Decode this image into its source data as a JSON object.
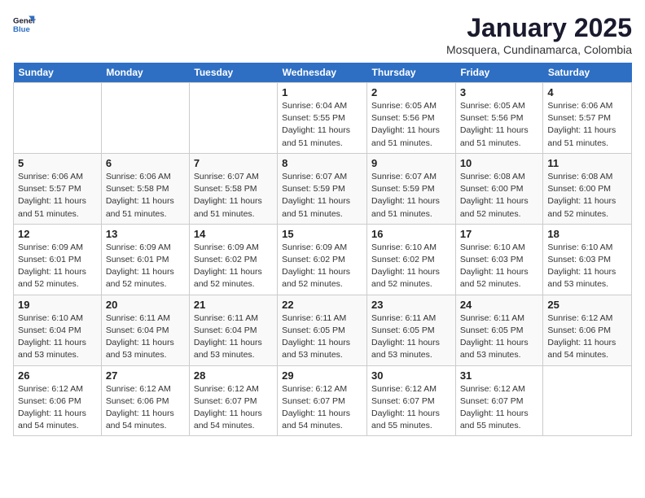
{
  "header": {
    "logo_line1": "General",
    "logo_line2": "Blue",
    "month": "January 2025",
    "location": "Mosquera, Cundinamarca, Colombia"
  },
  "days_of_week": [
    "Sunday",
    "Monday",
    "Tuesday",
    "Wednesday",
    "Thursday",
    "Friday",
    "Saturday"
  ],
  "weeks": [
    [
      {
        "day": "",
        "info": ""
      },
      {
        "day": "",
        "info": ""
      },
      {
        "day": "",
        "info": ""
      },
      {
        "day": "1",
        "info": "Sunrise: 6:04 AM\nSunset: 5:55 PM\nDaylight: 11 hours\nand 51 minutes."
      },
      {
        "day": "2",
        "info": "Sunrise: 6:05 AM\nSunset: 5:56 PM\nDaylight: 11 hours\nand 51 minutes."
      },
      {
        "day": "3",
        "info": "Sunrise: 6:05 AM\nSunset: 5:56 PM\nDaylight: 11 hours\nand 51 minutes."
      },
      {
        "day": "4",
        "info": "Sunrise: 6:06 AM\nSunset: 5:57 PM\nDaylight: 11 hours\nand 51 minutes."
      }
    ],
    [
      {
        "day": "5",
        "info": "Sunrise: 6:06 AM\nSunset: 5:57 PM\nDaylight: 11 hours\nand 51 minutes."
      },
      {
        "day": "6",
        "info": "Sunrise: 6:06 AM\nSunset: 5:58 PM\nDaylight: 11 hours\nand 51 minutes."
      },
      {
        "day": "7",
        "info": "Sunrise: 6:07 AM\nSunset: 5:58 PM\nDaylight: 11 hours\nand 51 minutes."
      },
      {
        "day": "8",
        "info": "Sunrise: 6:07 AM\nSunset: 5:59 PM\nDaylight: 11 hours\nand 51 minutes."
      },
      {
        "day": "9",
        "info": "Sunrise: 6:07 AM\nSunset: 5:59 PM\nDaylight: 11 hours\nand 51 minutes."
      },
      {
        "day": "10",
        "info": "Sunrise: 6:08 AM\nSunset: 6:00 PM\nDaylight: 11 hours\nand 52 minutes."
      },
      {
        "day": "11",
        "info": "Sunrise: 6:08 AM\nSunset: 6:00 PM\nDaylight: 11 hours\nand 52 minutes."
      }
    ],
    [
      {
        "day": "12",
        "info": "Sunrise: 6:09 AM\nSunset: 6:01 PM\nDaylight: 11 hours\nand 52 minutes."
      },
      {
        "day": "13",
        "info": "Sunrise: 6:09 AM\nSunset: 6:01 PM\nDaylight: 11 hours\nand 52 minutes."
      },
      {
        "day": "14",
        "info": "Sunrise: 6:09 AM\nSunset: 6:02 PM\nDaylight: 11 hours\nand 52 minutes."
      },
      {
        "day": "15",
        "info": "Sunrise: 6:09 AM\nSunset: 6:02 PM\nDaylight: 11 hours\nand 52 minutes."
      },
      {
        "day": "16",
        "info": "Sunrise: 6:10 AM\nSunset: 6:02 PM\nDaylight: 11 hours\nand 52 minutes."
      },
      {
        "day": "17",
        "info": "Sunrise: 6:10 AM\nSunset: 6:03 PM\nDaylight: 11 hours\nand 52 minutes."
      },
      {
        "day": "18",
        "info": "Sunrise: 6:10 AM\nSunset: 6:03 PM\nDaylight: 11 hours\nand 53 minutes."
      }
    ],
    [
      {
        "day": "19",
        "info": "Sunrise: 6:10 AM\nSunset: 6:04 PM\nDaylight: 11 hours\nand 53 minutes."
      },
      {
        "day": "20",
        "info": "Sunrise: 6:11 AM\nSunset: 6:04 PM\nDaylight: 11 hours\nand 53 minutes."
      },
      {
        "day": "21",
        "info": "Sunrise: 6:11 AM\nSunset: 6:04 PM\nDaylight: 11 hours\nand 53 minutes."
      },
      {
        "day": "22",
        "info": "Sunrise: 6:11 AM\nSunset: 6:05 PM\nDaylight: 11 hours\nand 53 minutes."
      },
      {
        "day": "23",
        "info": "Sunrise: 6:11 AM\nSunset: 6:05 PM\nDaylight: 11 hours\nand 53 minutes."
      },
      {
        "day": "24",
        "info": "Sunrise: 6:11 AM\nSunset: 6:05 PM\nDaylight: 11 hours\nand 53 minutes."
      },
      {
        "day": "25",
        "info": "Sunrise: 6:12 AM\nSunset: 6:06 PM\nDaylight: 11 hours\nand 54 minutes."
      }
    ],
    [
      {
        "day": "26",
        "info": "Sunrise: 6:12 AM\nSunset: 6:06 PM\nDaylight: 11 hours\nand 54 minutes."
      },
      {
        "day": "27",
        "info": "Sunrise: 6:12 AM\nSunset: 6:06 PM\nDaylight: 11 hours\nand 54 minutes."
      },
      {
        "day": "28",
        "info": "Sunrise: 6:12 AM\nSunset: 6:07 PM\nDaylight: 11 hours\nand 54 minutes."
      },
      {
        "day": "29",
        "info": "Sunrise: 6:12 AM\nSunset: 6:07 PM\nDaylight: 11 hours\nand 54 minutes."
      },
      {
        "day": "30",
        "info": "Sunrise: 6:12 AM\nSunset: 6:07 PM\nDaylight: 11 hours\nand 55 minutes."
      },
      {
        "day": "31",
        "info": "Sunrise: 6:12 AM\nSunset: 6:07 PM\nDaylight: 11 hours\nand 55 minutes."
      },
      {
        "day": "",
        "info": ""
      }
    ]
  ]
}
